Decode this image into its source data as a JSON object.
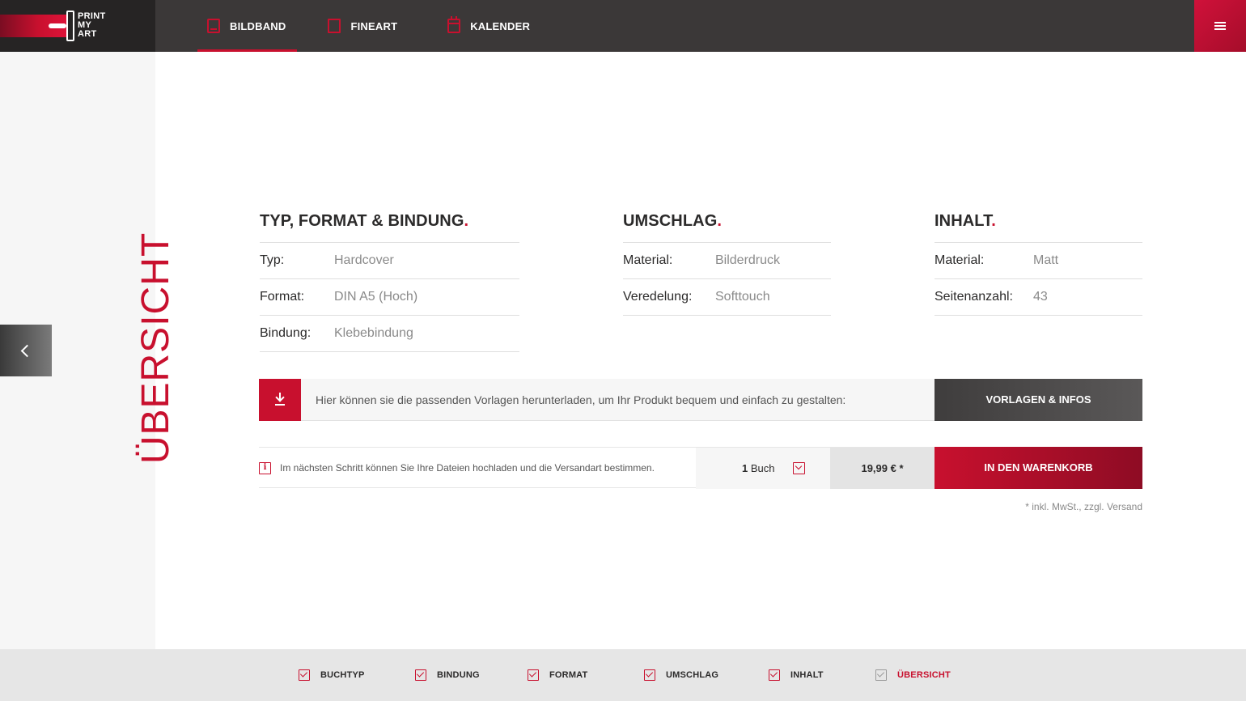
{
  "brand": {
    "logo_lines": [
      "PRINT",
      "MY",
      "ART"
    ]
  },
  "nav": [
    {
      "label": "BILDBAND",
      "icon": "book-icon",
      "active": true
    },
    {
      "label": "FINEART",
      "icon": "frame-icon",
      "active": false
    },
    {
      "label": "KALENDER",
      "icon": "calendar-icon",
      "active": false
    }
  ],
  "page": {
    "vertical_title": "ÜBERSICHT"
  },
  "sections": [
    {
      "title": "TYP, FORMAT & BINDUNG",
      "rows": [
        {
          "key": "Typ:",
          "value": "Hardcover"
        },
        {
          "key": "Format:",
          "value": "DIN A5 (Hoch)"
        },
        {
          "key": "Bindung:",
          "value": "Klebebindung"
        }
      ]
    },
    {
      "title": "UMSCHLAG",
      "rows": [
        {
          "key": "Material:",
          "value": "Bilderdruck"
        },
        {
          "key": "Veredelung:",
          "value": "Softtouch"
        }
      ]
    },
    {
      "title": "INHALT",
      "rows": [
        {
          "key": "Material:",
          "value": "Matt"
        },
        {
          "key": "Seitenanzahl:",
          "value": "43"
        }
      ]
    }
  ],
  "download": {
    "text": "Hier können sie die passenden Vorlagen herunterladen, um Ihr Produkt bequem und einfach zu gestalten:",
    "button": "VORLAGEN & INFOS"
  },
  "cart": {
    "info": "Im nächsten Schritt können Sie Ihre Dateien hochladen und die Versandart bestimmen.",
    "quantity": "1",
    "unit": "Buch",
    "price": "19,99 € *",
    "button": "IN DEN WARENKORB",
    "vat_note": "* inkl. MwSt., zzgl. Versand"
  },
  "steps": [
    {
      "label": "BUCHTYP",
      "done": true
    },
    {
      "label": "BINDUNG",
      "done": true
    },
    {
      "label": "FORMAT",
      "done": true
    },
    {
      "label": "UMSCHLAG",
      "done": true
    },
    {
      "label": "INHALT",
      "done": true
    },
    {
      "label": "ÜBERSICHT",
      "current": true
    }
  ],
  "colors": {
    "accent": "#c8102e",
    "topbar": "#3b3838",
    "text": "#2b2a2a",
    "muted": "#8a8a8a"
  }
}
